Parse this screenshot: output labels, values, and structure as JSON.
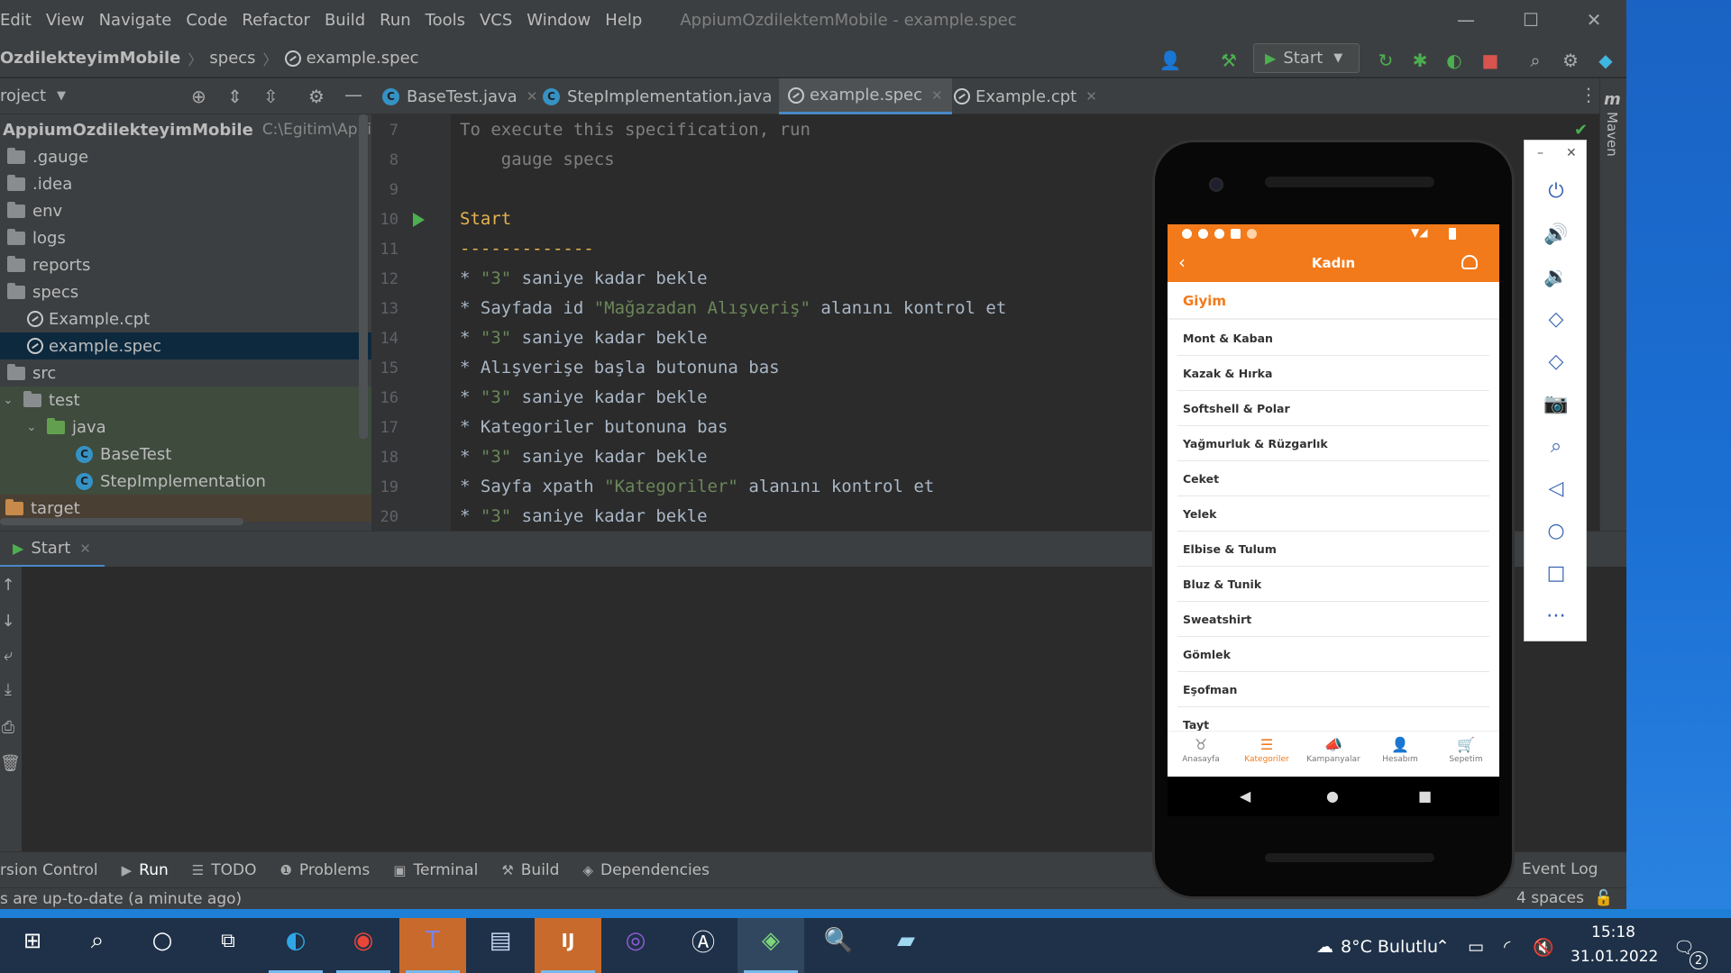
{
  "ide": {
    "menu": [
      "Edit",
      "View",
      "Navigate",
      "Code",
      "Refactor",
      "Build",
      "Run",
      "Tools",
      "VCS",
      "Window",
      "Help"
    ],
    "window_title": "AppiumOzdilektemMobile - example.spec",
    "breadcrumbs": [
      "OzdilekteyimMobile",
      "specs",
      "example.spec"
    ],
    "run_config": "Start",
    "project_header": "roject",
    "project_tree": [
      {
        "label": "AppiumOzdilekteyimMobile",
        "path": "C:\\Egitim\\AppiumO",
        "kind": "root"
      },
      {
        "label": ".gauge",
        "kind": "folder"
      },
      {
        "label": ".idea",
        "kind": "folder"
      },
      {
        "label": "env",
        "kind": "folder"
      },
      {
        "label": "logs",
        "kind": "folder"
      },
      {
        "label": "reports",
        "kind": "folder"
      },
      {
        "label": "specs",
        "kind": "folder"
      },
      {
        "label": "Example.cpt",
        "kind": "spec"
      },
      {
        "label": "example.spec",
        "kind": "spec",
        "selected": true
      },
      {
        "label": "src",
        "kind": "folder"
      },
      {
        "label": "test",
        "kind": "folder"
      },
      {
        "label": "java",
        "kind": "folder-green"
      },
      {
        "label": "BaseTest",
        "kind": "class"
      },
      {
        "label": "StepImplementation",
        "kind": "class"
      },
      {
        "label": "target",
        "kind": "folder-orange"
      }
    ],
    "tabs": [
      {
        "label": "BaseTest.java",
        "kind": "class"
      },
      {
        "label": "StepImplementation.java",
        "kind": "class"
      },
      {
        "label": "example.spec",
        "kind": "spec",
        "active": true
      },
      {
        "label": "Example.cpt",
        "kind": "spec"
      }
    ],
    "code_lines": [
      {
        "num": "7",
        "text": "To execute this specification, run"
      },
      {
        "num": "8",
        "text": "    gauge specs"
      },
      {
        "num": "9",
        "text": ""
      },
      {
        "num": "10",
        "text": "Start"
      },
      {
        "num": "11",
        "text": "-------------"
      },
      {
        "num": "12",
        "pre": "* ",
        "str": "\"3\"",
        "post": " saniye kadar bekle"
      },
      {
        "num": "13",
        "pre": "* Sayfada id ",
        "str": "\"Mağazadan Alışveriş\"",
        "post": " alanını kontrol et"
      },
      {
        "num": "14",
        "pre": "* ",
        "str": "\"3\"",
        "post": " saniye kadar bekle"
      },
      {
        "num": "15",
        "pre": "* Alışverişe başla butonuna bas",
        "str": "",
        "post": ""
      },
      {
        "num": "16",
        "pre": "* ",
        "str": "\"3\"",
        "post": " saniye kadar bekle"
      },
      {
        "num": "17",
        "pre": "* Kategoriler butonuna bas",
        "str": "",
        "post": ""
      },
      {
        "num": "18",
        "pre": "* ",
        "str": "\"3\"",
        "post": " saniye kadar bekle"
      },
      {
        "num": "19",
        "pre": "* Sayfa xpath ",
        "str": "\"Kategoriler\"",
        "post": " alanını kontrol et"
      },
      {
        "num": "20",
        "pre": "* ",
        "str": "\"3\"",
        "post": " saniye kadar bekle"
      }
    ],
    "run_tab": "Start",
    "tool_windows": [
      {
        "label": "rsion Control",
        "icon": ""
      },
      {
        "label": "Run",
        "icon": "▶"
      },
      {
        "label": "TODO",
        "icon": "☰"
      },
      {
        "label": "Problems",
        "icon": "❶"
      },
      {
        "label": "Terminal",
        "icon": "▣"
      },
      {
        "label": "Build",
        "icon": "⚒"
      },
      {
        "label": "Dependencies",
        "icon": "◈"
      }
    ],
    "event_log": "Event Log",
    "status_text": "s are up-to-date (a minute ago)",
    "indent": "4 spaces",
    "maven": "Maven"
  },
  "phone": {
    "title": "Kadın",
    "section": "Giyim",
    "categories": [
      "Mont & Kaban",
      "Kazak & Hırka",
      "Softshell & Polar",
      "Yağmurluk & Rüzgarlık",
      "Ceket",
      "Yelek",
      "Elbise & Tulum",
      "Bluz & Tunik",
      "Sweatshirt",
      "Gömlek",
      "Eşofman",
      "Tayt"
    ],
    "nav": [
      {
        "label": "Anasayfa",
        "icon": "♉"
      },
      {
        "label": "Kategoriler",
        "icon": "☰",
        "active": true
      },
      {
        "label": "Kampanyalar",
        "icon": "📣"
      },
      {
        "label": "Hesabım",
        "icon": "👤"
      },
      {
        "label": "Sepetim",
        "icon": "🛒"
      }
    ],
    "accent": "#f27a1a"
  },
  "taskbar": {
    "weather": "8°C  Bulutlu",
    "time": "15:18",
    "date": "31.01.2022",
    "notifications": "2"
  }
}
